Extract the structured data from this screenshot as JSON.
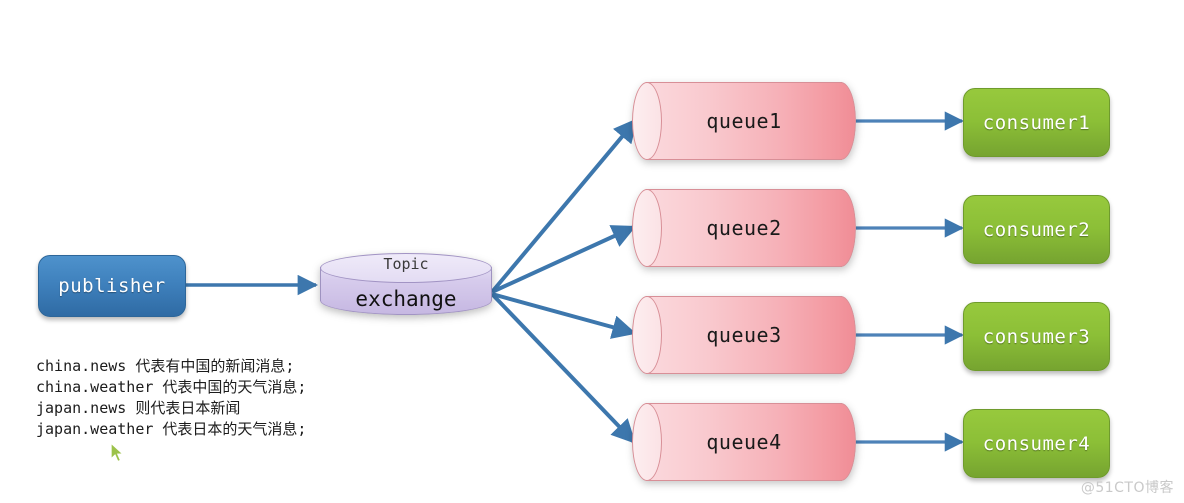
{
  "diagram": {
    "publisher": {
      "label": "publisher",
      "color": "#3f81bd"
    },
    "exchange": {
      "type_label": "Topic",
      "label": "exchange",
      "color": "#d6cbec"
    },
    "queues": [
      {
        "label": "queue1"
      },
      {
        "label": "queue2"
      },
      {
        "label": "queue3"
      },
      {
        "label": "queue4"
      }
    ],
    "consumers": [
      {
        "label": "consumer1"
      },
      {
        "label": "consumer2"
      },
      {
        "label": "consumer3"
      },
      {
        "label": "consumer4"
      }
    ],
    "queue_color": "#f6afb6",
    "consumer_color": "#8cbf37",
    "arrow_color": "#3d77ad"
  },
  "legend": {
    "lines": [
      "china.news 代表有中国的新闻消息;",
      "china.weather 代表中国的天气消息;",
      "japan.news 则代表日本新闻",
      "japan.weather 代表日本的天气消息;"
    ]
  },
  "watermark": {
    "text": "@51CTO博客"
  }
}
